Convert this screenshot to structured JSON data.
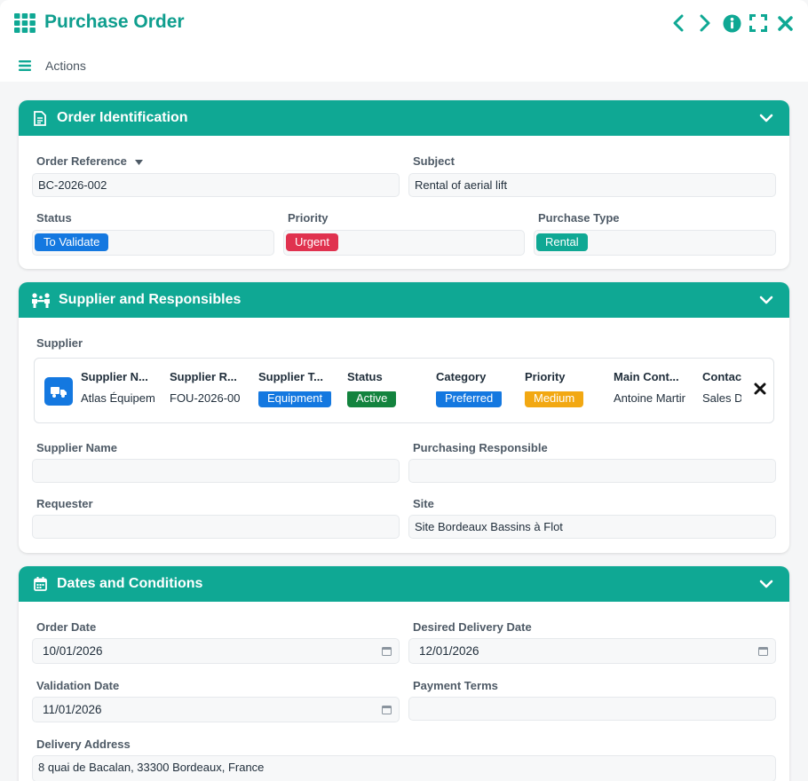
{
  "app": {
    "title": "Purchase Order",
    "actions_label": "Actions"
  },
  "colors": {
    "accent": "#0fa894",
    "title": "#0f9e8e",
    "blue": "#1478e0",
    "red": "#e0324f",
    "green": "#13833e",
    "amber": "#f2a812"
  },
  "sections": {
    "identification": {
      "title": "Order Identification",
      "order_reference_label": "Order Reference",
      "order_reference_value": "BC-2026-002",
      "subject_label": "Subject",
      "subject_value": "Rental of aerial lift",
      "status_label": "Status",
      "status_value": "To Validate",
      "priority_label": "Priority",
      "priority_value": "Urgent",
      "purchase_type_label": "Purchase Type",
      "purchase_type_value": "Rental"
    },
    "supplier": {
      "title": "Supplier and Responsibles",
      "supplier_label": "Supplier",
      "card": {
        "columns": [
          {
            "header": "Supplier N...",
            "value": "Atlas Équipem"
          },
          {
            "header": "Supplier R...",
            "value": "FOU-2026-00"
          },
          {
            "header": "Supplier T...",
            "value": "Equipment"
          },
          {
            "header": "Status",
            "value": "Active"
          },
          {
            "header": "Category",
            "value": "Preferred"
          },
          {
            "header": "Priority",
            "value": "Medium"
          },
          {
            "header": "Main Cont...",
            "value": "Antoine Martir"
          },
          {
            "header": "Contac",
            "value": "Sales D"
          }
        ]
      },
      "supplier_name_label": "Supplier Name",
      "supplier_name_value": "",
      "purchasing_responsible_label": "Purchasing Responsible",
      "purchasing_responsible_value": "",
      "requester_label": "Requester",
      "requester_value": "",
      "site_label": "Site",
      "site_value": "Site Bordeaux Bassins à Flot"
    },
    "dates": {
      "title": "Dates and Conditions",
      "order_date_label": "Order Date",
      "order_date_value": "10/01/2026",
      "desired_delivery_label": "Desired Delivery Date",
      "desired_delivery_value": "12/01/2026",
      "validation_date_label": "Validation Date",
      "validation_date_value": "11/01/2026",
      "payment_terms_label": "Payment Terms",
      "payment_terms_value": "",
      "delivery_address_label": "Delivery Address",
      "delivery_address_value": "8 quai de Bacalan, 33300 Bordeaux, France"
    }
  },
  "icons": {
    "app": "grid-icon",
    "prev": "chevron-left-icon",
    "next": "chevron-right-icon",
    "info": "info-icon",
    "expand": "expand-icon",
    "close": "close-icon",
    "menu": "hamburger-icon",
    "document": "document-icon",
    "people": "people-icon",
    "calendar": "calendar-icon",
    "truck": "truck-icon"
  }
}
